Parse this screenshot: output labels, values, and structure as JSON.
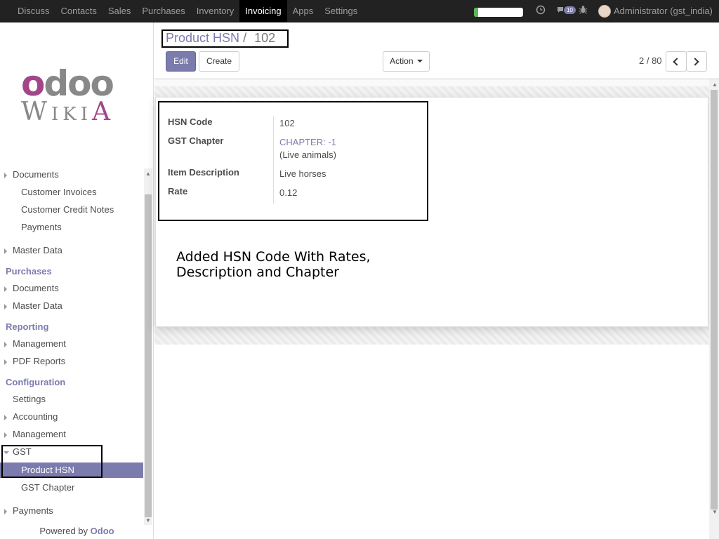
{
  "topbar": {
    "menu": [
      "Discuss",
      "Contacts",
      "Sales",
      "Purchases",
      "Inventory",
      "Invoicing",
      "Apps",
      "Settings"
    ],
    "active_menu": "Invoicing",
    "progress_fraction": 0.08,
    "messages_count": "10",
    "user": "Administrator (gst_india)",
    "icons": {
      "activity": "clock-icon",
      "messages": "chat-icon",
      "debug": "bug-icon"
    }
  },
  "sidebar": {
    "logo_top": "odoo",
    "logo_bottom": "WIKIA",
    "items": [
      {
        "label": "Documents",
        "kind": "l1",
        "caret": "right"
      },
      {
        "label": "Customer Invoices",
        "kind": "l2"
      },
      {
        "label": "Customer Credit Notes",
        "kind": "l2"
      },
      {
        "label": "Payments",
        "kind": "l2"
      },
      {
        "label": "Master Data",
        "kind": "l1",
        "caret": "right"
      },
      {
        "label": "Purchases",
        "kind": "sec"
      },
      {
        "label": "Documents",
        "kind": "l1",
        "caret": "right"
      },
      {
        "label": "Master Data",
        "kind": "l1",
        "caret": "right"
      },
      {
        "label": "Reporting",
        "kind": "sec"
      },
      {
        "label": "Management",
        "kind": "l1",
        "caret": "right"
      },
      {
        "label": "PDF Reports",
        "kind": "l1",
        "caret": "right"
      },
      {
        "label": "Configuration",
        "kind": "sec"
      },
      {
        "label": "Settings",
        "kind": "l1"
      },
      {
        "label": "Accounting",
        "kind": "l1",
        "caret": "right"
      },
      {
        "label": "Management",
        "kind": "l1",
        "caret": "right"
      },
      {
        "label": "GST",
        "kind": "l1",
        "caret": "down"
      },
      {
        "label": "Product HSN",
        "kind": "l2",
        "selected": true
      },
      {
        "label": "GST Chapter",
        "kind": "l2"
      },
      {
        "label": "Payments",
        "kind": "l1",
        "caret": "right"
      }
    ],
    "powered_by": "Powered by",
    "powered_brand": "Odoo"
  },
  "control_panel": {
    "breadcrumb_parent": "Product HSN",
    "breadcrumb_sep": "/",
    "breadcrumb_current": "102",
    "edit_label": "Edit",
    "create_label": "Create",
    "action_label": "Action",
    "pager": "2 / 80"
  },
  "form": {
    "hsn_code_label": "HSN Code",
    "hsn_code_value": "102",
    "gst_chapter_label": "GST Chapter",
    "gst_chapter_value": "CHAPTER: -1",
    "gst_chapter_sub": "(Live animals)",
    "description_label": "Item Description",
    "description_value": "Live horses",
    "rate_label": "Rate",
    "rate_value": "0.12"
  },
  "annotation": {
    "line1": "Added HSN Code With Rates,",
    "line2": "Description and Chapter"
  }
}
